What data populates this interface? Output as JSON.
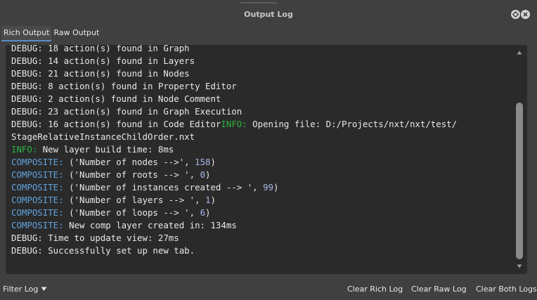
{
  "window": {
    "title": "Output Log"
  },
  "tabs": [
    {
      "label": "Rich Output",
      "active": true
    },
    {
      "label": "Raw Output",
      "active": false
    }
  ],
  "log": {
    "lines": [
      [
        {
          "t": "DEBUG: 18 action(s) found in Graph",
          "c": "d"
        }
      ],
      [
        {
          "t": "DEBUG: 14 action(s) found in Layers",
          "c": "d"
        }
      ],
      [
        {
          "t": "DEBUG: 21 action(s) found in Nodes",
          "c": "d"
        }
      ],
      [
        {
          "t": "DEBUG: 8 action(s) found in Property Editor",
          "c": "d"
        }
      ],
      [
        {
          "t": "DEBUG: 2 action(s) found in Node Comment",
          "c": "d"
        }
      ],
      [
        {
          "t": "DEBUG: 23 action(s) found in Graph Execution",
          "c": "d"
        }
      ],
      [
        {
          "t": "DEBUG: 16 action(s) found in Code Editor",
          "c": "d"
        },
        {
          "t": "INFO: ",
          "c": "i"
        },
        {
          "t": "Opening file: D:/Projects/nxt/nxt/test/",
          "c": "d"
        }
      ],
      [
        {
          "t": "StageRelativeInstanceChildOrder.nxt",
          "c": "d"
        }
      ],
      [
        {
          "t": "INFO: ",
          "c": "i"
        },
        {
          "t": "New layer build time: 8ms",
          "c": "d"
        }
      ],
      [
        {
          "t": "COMPOSITE: ",
          "c": "b"
        },
        {
          "t": "('Number of nodes -->', ",
          "c": "d"
        },
        {
          "t": "158",
          "c": "n"
        },
        {
          "t": ")",
          "c": "d"
        }
      ],
      [
        {
          "t": "COMPOSITE: ",
          "c": "b"
        },
        {
          "t": "('Number of roots --> ', ",
          "c": "d"
        },
        {
          "t": "0",
          "c": "n"
        },
        {
          "t": ")",
          "c": "d"
        }
      ],
      [
        {
          "t": "COMPOSITE: ",
          "c": "b"
        },
        {
          "t": "('Number of instances created --> ', ",
          "c": "d"
        },
        {
          "t": "99",
          "c": "n"
        },
        {
          "t": ")",
          "c": "d"
        }
      ],
      [
        {
          "t": "COMPOSITE: ",
          "c": "b"
        },
        {
          "t": "('Number of layers --> ', ",
          "c": "d"
        },
        {
          "t": "1",
          "c": "n"
        },
        {
          "t": ")",
          "c": "d"
        }
      ],
      [
        {
          "t": "COMPOSITE: ",
          "c": "b"
        },
        {
          "t": "('Number of loops --> ', ",
          "c": "d"
        },
        {
          "t": "6",
          "c": "n"
        },
        {
          "t": ")",
          "c": "d"
        }
      ],
      [
        {
          "t": "COMPOSITE: ",
          "c": "b"
        },
        {
          "t": "New comp layer created in: 134ms",
          "c": "d"
        }
      ],
      [
        {
          "t": "DEBUG: Time to update view: 27ms",
          "c": "d"
        }
      ],
      [
        {
          "t": "DEBUG: Successfully set up new tab.",
          "c": "d"
        }
      ]
    ]
  },
  "footer": {
    "filter_label": "Filter Log",
    "clear_rich": "Clear Rich Log",
    "clear_raw": "Clear Raw Log",
    "clear_both": "Clear Both Logs"
  },
  "icons": {
    "float": "float-icon",
    "close": "close-icon",
    "filter_dropdown": "triangle-down-icon",
    "scroll_up": "scroll-up-arrow-icon",
    "scroll_down": "scroll-down-arrow-icon"
  },
  "colors": {
    "debug": "#e8e8e8",
    "info": "#2db340",
    "composite": "#62a3de",
    "number": "#a9b8ea",
    "active_tab": "#5a8ec8"
  }
}
